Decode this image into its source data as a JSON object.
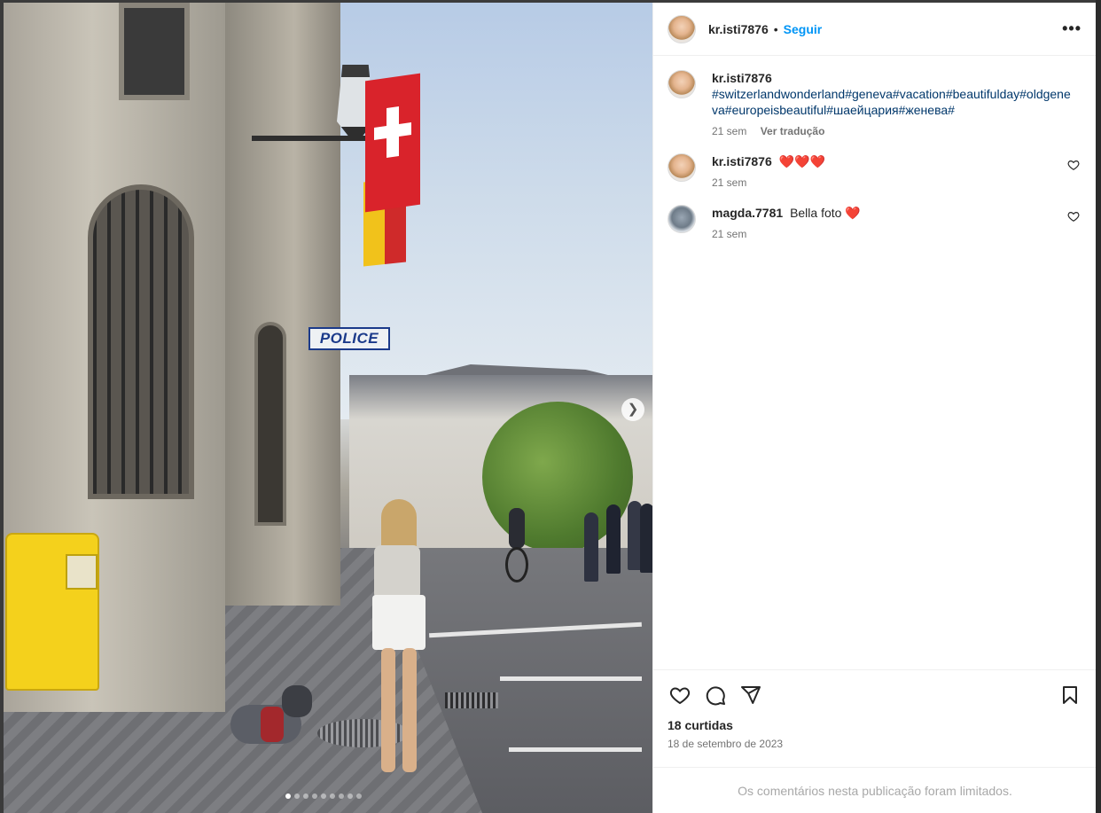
{
  "post": {
    "username": "kr.isti7876",
    "follow_label": "Seguir",
    "separator": "•",
    "more_label": "•••",
    "caption": {
      "username": "kr.isti7876",
      "hashtags": "#switzerlandwonderland#geneva#vacation#beautifulday#oldgeneva#europeisbeautiful#шаейцария#женева#",
      "time": "21 sem",
      "translate_label": "Ver tradução"
    },
    "comments": [
      {
        "username": "kr.isti7876",
        "text": "",
        "hearts": "❤️❤️❤️",
        "time": "21 sem"
      },
      {
        "username": "magda.7781",
        "text": "Bella foto",
        "hearts": "❤️",
        "time": "21 sem"
      }
    ],
    "likes_label": "18 curtidas",
    "date_label": "18 de setembro de 2023",
    "comments_limited": "Os comentários nesta publicação foram limitados."
  },
  "media": {
    "sign_text": "POLICE",
    "next_icon": "chevron-right-icon",
    "carousel_count": 9,
    "carousel_active": 1
  },
  "colors": {
    "link": "#0095f6",
    "hashtag": "#00376b",
    "muted": "#737373",
    "heart": "#e0245e"
  }
}
